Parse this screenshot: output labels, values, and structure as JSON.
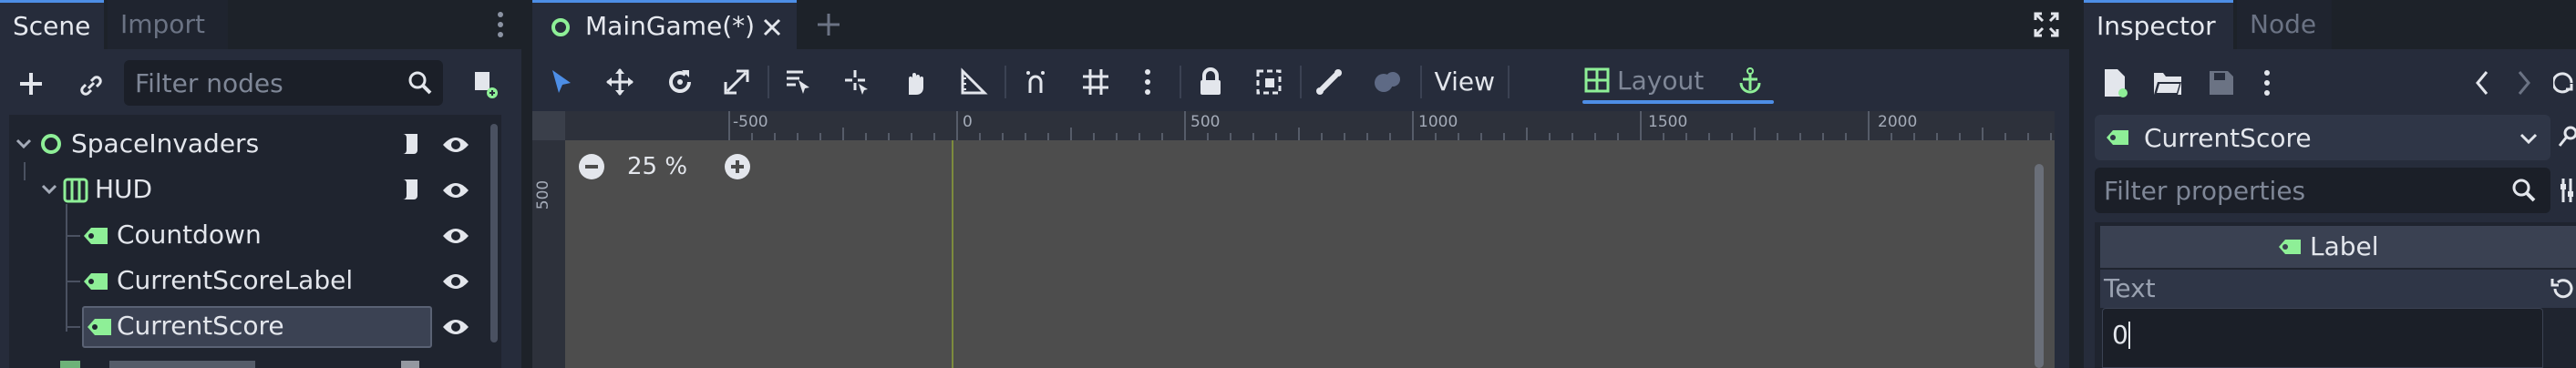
{
  "colors": {
    "accent": "#4d8ee6",
    "node_green": "#8eef97",
    "bg_dark": "#1d2229",
    "panel": "#262c3b",
    "viewport": "#4d4d4d"
  },
  "scene_dock": {
    "tabs": [
      "Scene",
      "Import"
    ],
    "filter_placeholder": "Filter nodes",
    "tree": [
      {
        "label": "SpaceInvaders",
        "icon": "node2d-circle-icon",
        "script": true,
        "visible": true
      },
      {
        "label": "HUD",
        "icon": "hbox-container-icon",
        "script": true,
        "visible": true
      },
      {
        "label": "Countdown",
        "icon": "label-tag-icon",
        "script": false,
        "visible": true
      },
      {
        "label": "CurrentScoreLabel",
        "icon": "label-tag-icon",
        "script": false,
        "visible": true
      },
      {
        "label": "CurrentScore",
        "icon": "label-tag-icon",
        "script": false,
        "visible": true,
        "selected": true
      }
    ]
  },
  "editor": {
    "tab_label": "MainGame(*)",
    "view_menu": "View",
    "layout_menu": "Layout",
    "zoom": "25 %",
    "ruler_marks": [
      "-500",
      "0",
      "500",
      "1000",
      "1500",
      "2000"
    ],
    "vruler_mark": "500"
  },
  "inspector": {
    "tabs": [
      "Inspector",
      "Node"
    ],
    "object_name": "CurrentScore",
    "filter_placeholder": "Filter properties",
    "section": "Label",
    "property_name": "Text",
    "property_value": "0"
  }
}
